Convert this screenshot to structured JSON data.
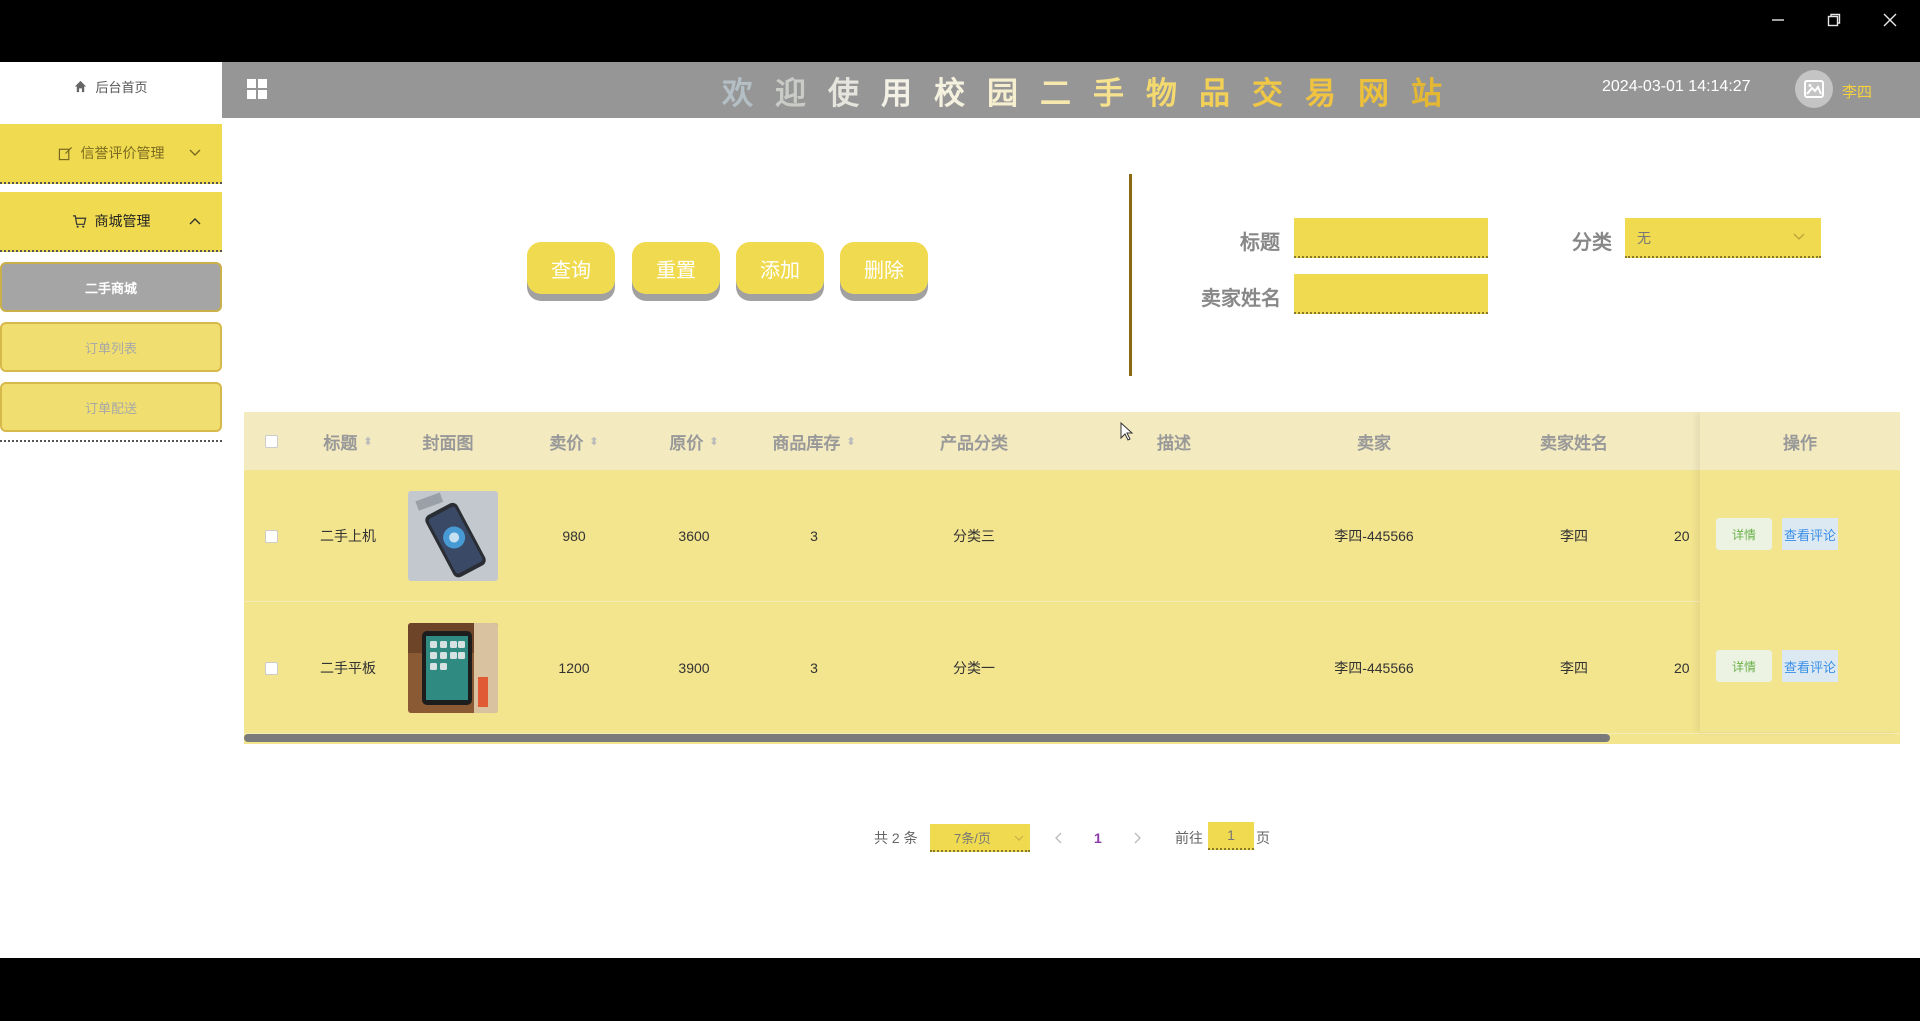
{
  "window": {
    "controls": [
      "minimize",
      "restore",
      "close"
    ]
  },
  "sidebar": {
    "home_label": "后台首页",
    "groups": [
      {
        "label": "信誉评价管理",
        "expanded": false
      },
      {
        "label": "商城管理",
        "expanded": true
      }
    ],
    "sub_items": [
      {
        "label": "二手商城",
        "active": true
      },
      {
        "label": "订单列表",
        "active": false
      },
      {
        "label": "订单配送",
        "active": false
      }
    ]
  },
  "header": {
    "title_chars": [
      "欢",
      "迎",
      "使",
      "用",
      "校",
      "园",
      "二",
      "手",
      "物",
      "品",
      "交",
      "易",
      "网",
      "站"
    ],
    "title_colors": [
      "#b3bfc4",
      "#c9ccc6",
      "#e5e4dd",
      "#f3f0e6",
      "#f5f1df",
      "#f6efcf",
      "#f7e8ae",
      "#f6e18f",
      "#f4d96f",
      "#f2d055",
      "#f0c845",
      "#f0c340",
      "#eec13a",
      "#e5b834"
    ],
    "datetime": "2024-03-01 14:14:27",
    "username": "李四"
  },
  "actions": {
    "query": "查询",
    "reset": "重置",
    "add": "添加",
    "delete": "删除"
  },
  "filters": {
    "title_label": "标题",
    "title_value": "",
    "category_label": "分类",
    "category_value": "无",
    "seller_name_label": "卖家姓名",
    "seller_name_value": ""
  },
  "table": {
    "headers": {
      "title": "标题",
      "cover": "封面图",
      "price": "卖价",
      "original_price": "原价",
      "stock": "商品库存",
      "category": "产品分类",
      "description": "描述",
      "seller": "卖家",
      "seller_name": "卖家姓名",
      "operations": "操作"
    },
    "rows": [
      {
        "title": "二手上机",
        "cover": "phone-image",
        "price": "980",
        "original_price": "3600",
        "stock": "3",
        "category": "分类三",
        "description": "",
        "seller": "李四-445566",
        "seller_name": "李四",
        "extra": "20",
        "detail": "详情",
        "review": "查看评论"
      },
      {
        "title": "二手平板",
        "cover": "tablet-image",
        "price": "1200",
        "original_price": "3900",
        "stock": "3",
        "category": "分类一",
        "description": "",
        "seller": "李四-445566",
        "seller_name": "李四",
        "extra": "20",
        "detail": "详情",
        "review": "查看评论"
      }
    ]
  },
  "pagination": {
    "total": "共 2 条",
    "page_size": "7条/页",
    "current_page": "1",
    "goto_prefix": "前往",
    "goto_value": "1",
    "goto_suffix": "页"
  },
  "colors": {
    "accent": "#f0da50",
    "header": "#969696",
    "row": "#f3e48e",
    "table_head": "#f3eac0"
  }
}
